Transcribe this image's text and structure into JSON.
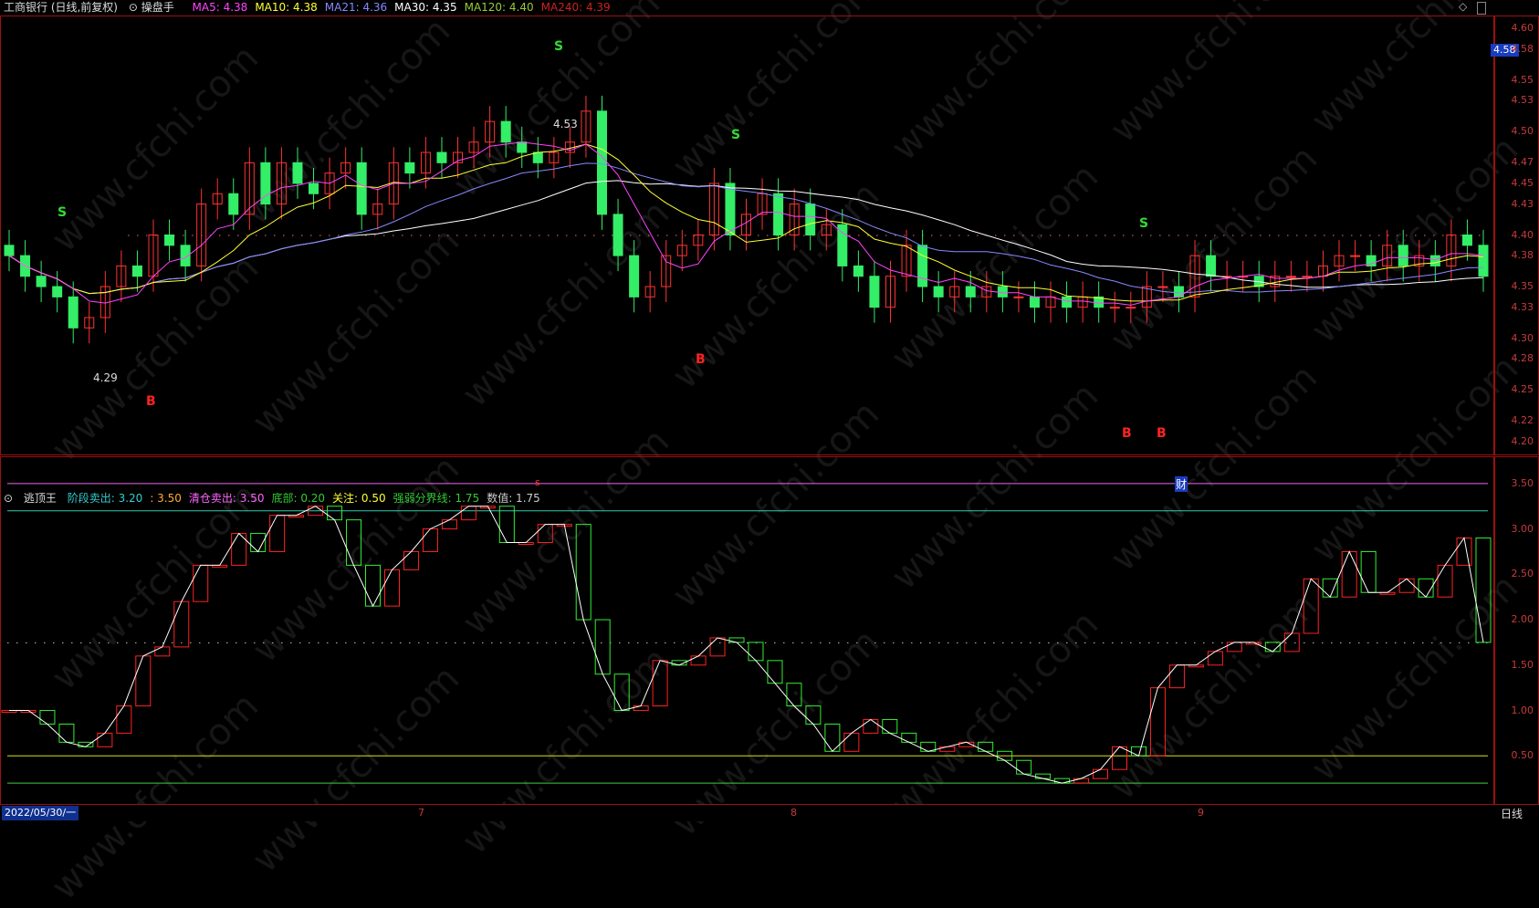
{
  "header": {
    "title": "工商银行 (日线,前复权)",
    "indicator_name": "操盘手",
    "ma": [
      {
        "label": "MA5: 4.38",
        "color": "#ff44ff"
      },
      {
        "label": "MA10: 4.38",
        "color": "#ffff33"
      },
      {
        "label": "MA21: 4.36",
        "color": "#8888ff"
      },
      {
        "label": "MA30: 4.35",
        "color": "#ffffff"
      },
      {
        "label": "MA120: 4.40",
        "color": "#9acd32"
      },
      {
        "label": "MA240: 4.39",
        "color": "#cc2222"
      }
    ]
  },
  "sub_header": {
    "title": "逃顶王",
    "items": [
      {
        "label": "阶段卖出: 3.20",
        "color": "#33cccc"
      },
      {
        "label": ": 3.50",
        "color": "#ffaa33"
      },
      {
        "label": "清仓卖出: 3.50",
        "color": "#ff66ff"
      },
      {
        "label": "底部: 0.20",
        "color": "#33cc33"
      },
      {
        "label": "关注: 0.50",
        "color": "#ffff33"
      },
      {
        "label": "强弱分界线: 1.75",
        "color": "#33cc33"
      },
      {
        "label": "数值: 1.75",
        "color": "#cccccc"
      }
    ]
  },
  "price_axis": [
    "4.60",
    "4.58",
    "4.55",
    "4.53",
    "4.50",
    "4.47",
    "4.45",
    "4.43",
    "4.40",
    "4.38",
    "4.35",
    "4.33",
    "4.30",
    "4.28",
    "4.25",
    "4.22",
    "4.20"
  ],
  "sub_axis": [
    "3.50",
    "3.00",
    "2.50",
    "2.00",
    "1.50",
    "1.00",
    "0.50"
  ],
  "current_price": "4.58",
  "annotations": {
    "high_label": "4.53",
    "low_label": "4.29",
    "cai": "财",
    "s_small": "s"
  },
  "bottom": {
    "date": "2022/05/30/一",
    "months": [
      "7",
      "8",
      "9"
    ],
    "period_tab": "日线"
  },
  "watermark": "www.cfchi.com",
  "signals": [
    "S",
    "S",
    "S",
    "S",
    "B",
    "B",
    "B",
    "B"
  ],
  "chart_data": [
    {
      "type": "candlestick",
      "title": "工商银行 (日线,前复权)",
      "ylim": [
        4.19,
        4.61
      ],
      "closes": [
        4.38,
        4.36,
        4.35,
        4.34,
        4.31,
        4.32,
        4.35,
        4.37,
        4.36,
        4.4,
        4.39,
        4.37,
        4.43,
        4.44,
        4.42,
        4.47,
        4.43,
        4.47,
        4.45,
        4.44,
        4.46,
        4.47,
        4.42,
        4.43,
        4.47,
        4.46,
        4.48,
        4.47,
        4.48,
        4.49,
        4.51,
        4.49,
        4.48,
        4.47,
        4.48,
        4.49,
        4.52,
        4.42,
        4.38,
        4.34,
        4.35,
        4.38,
        4.39,
        4.4,
        4.45,
        4.4,
        4.42,
        4.44,
        4.4,
        4.43,
        4.4,
        4.41,
        4.37,
        4.36,
        4.33,
        4.36,
        4.39,
        4.35,
        4.34,
        4.35,
        4.34,
        4.35,
        4.34,
        4.34,
        4.33,
        4.34,
        4.33,
        4.34,
        4.33,
        4.33,
        4.33,
        4.35,
        4.35,
        4.34,
        4.38,
        4.36,
        4.36,
        4.36,
        4.35,
        4.36,
        4.36,
        4.36,
        4.37,
        4.38,
        4.38,
        4.37,
        4.39,
        4.37,
        4.38,
        4.37,
        4.4,
        4.39,
        4.36
      ]
    },
    {
      "type": "line",
      "title": "逃顶王",
      "ylim": [
        0.0,
        3.75
      ],
      "reference_lines": [
        3.5,
        3.2,
        1.75,
        0.5,
        0.2
      ],
      "values": [
        1.0,
        1.0,
        0.85,
        0.65,
        0.6,
        0.75,
        1.05,
        1.6,
        1.7,
        2.2,
        2.6,
        2.6,
        2.95,
        2.75,
        3.15,
        3.15,
        3.25,
        3.1,
        2.6,
        2.15,
        2.55,
        2.75,
        3.0,
        3.1,
        3.25,
        3.25,
        2.85,
        2.85,
        3.05,
        3.05,
        2.0,
        1.4,
        1.0,
        1.05,
        1.55,
        1.5,
        1.6,
        1.8,
        1.75,
        1.55,
        1.3,
        1.05,
        0.85,
        0.55,
        0.75,
        0.9,
        0.75,
        0.65,
        0.55,
        0.6,
        0.65,
        0.55,
        0.45,
        0.3,
        0.25,
        0.2,
        0.25,
        0.35,
        0.6,
        0.5,
        1.25,
        1.5,
        1.5,
        1.65,
        1.75,
        1.75,
        1.65,
        1.85,
        2.45,
        2.25,
        2.75,
        2.3,
        2.3,
        2.45,
        2.25,
        2.6,
        2.9,
        1.75
      ]
    }
  ]
}
